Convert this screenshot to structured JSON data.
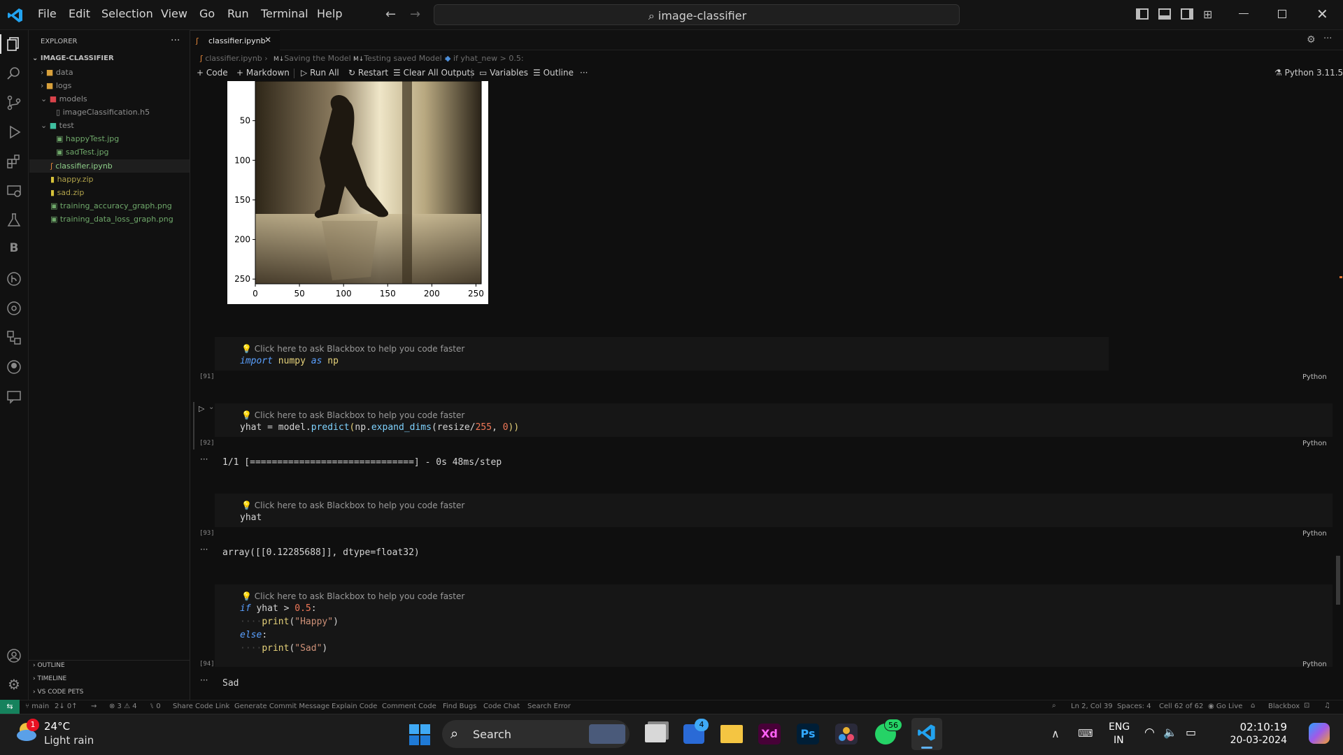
{
  "menu": [
    "File",
    "Edit",
    "Selection",
    "View",
    "Go",
    "Run",
    "Terminal",
    "Help"
  ],
  "search_title": "image-classifier",
  "explorer": {
    "title": "EXPLORER",
    "root": "IMAGE-CLASSIFIER",
    "items": [
      "data",
      "logs",
      "models",
      "imageClassification.h5",
      "test",
      "happyTest.jpg",
      "sadTest.jpg",
      "classifier.ipynb",
      "happy.zip",
      "sad.zip",
      "training_accuracy_graph.png",
      "training_data_loss_graph.png"
    ],
    "sections": [
      "OUTLINE",
      "TIMELINE",
      "VS CODE PETS"
    ]
  },
  "tab": {
    "label": "classifier.ipynb"
  },
  "breadcrumb": [
    "classifier.ipynb",
    "Saving the Model",
    "Testing saved Model",
    "if yhat_new > 0.5:"
  ],
  "toolbar": {
    "code": "Code",
    "markdown": "Markdown",
    "run_all": "Run All",
    "restart": "Restart",
    "clear": "Clear All Outputs",
    "variables": "Variables",
    "outline": "Outline",
    "kernel": "Python 3.11.5"
  },
  "plot": {
    "y_ticks": [
      "50",
      "100",
      "150",
      "200",
      "250"
    ],
    "x_ticks": [
      "0",
      "50",
      "100",
      "150",
      "200",
      "250"
    ]
  },
  "cells": [
    {
      "hint": "Click here to ask Blackbox to help you code faster",
      "num": "[91]",
      "lang": "Python",
      "code": {
        "kw": "import",
        "mod": "numpy",
        "as": "as",
        "alias": "np"
      }
    },
    {
      "hint": "Click here to ask Blackbox to help you code faster",
      "num": "[92]",
      "lang": "Python",
      "code": {
        "a": "yhat = model.",
        "fn": "predict",
        "b": "(np.",
        "fn2": "expand_dims",
        "c": "(resize/",
        "n1": "255",
        "d": ", ",
        "n2": "0",
        "e": "))"
      },
      "output": "1/1 [==============================] - 0s 48ms/step"
    },
    {
      "hint": "Click here to ask Blackbox to help you code faster",
      "num": "[93]",
      "lang": "Python",
      "code": {
        "a": "yhat"
      },
      "output": "array([[0.12285688]], dtype=float32)"
    },
    {
      "hint": "Click here to ask Blackbox to help you code faster",
      "num": "[94]",
      "lang": "Python",
      "code": {
        "if": "if",
        "cond": " yhat > ",
        "n": "0.5",
        ":": ":",
        "print": "print",
        "happy": "\"Happy\"",
        "else": "else",
        "sad": "\"Sad\""
      },
      "output": "Sad"
    }
  ],
  "status": {
    "branch": "main",
    "sync": "2↓ 0↑",
    "errors": "⊗ 3 ⚠ 4",
    "ports": "0",
    "actions": [
      "Share Code Link",
      "Generate Commit Message",
      "Explain Code",
      "Comment Code",
      "Find Bugs",
      "Code Chat",
      "Search Error"
    ],
    "right": [
      "Ln 2, Col 39",
      "Spaces: 4",
      "Cell 62 of 62",
      "Go Live",
      "Blackbox"
    ]
  },
  "taskbar": {
    "weather_temp": "24°C",
    "weather_desc": "Light rain",
    "weather_badge": "1",
    "search": "Search",
    "mail_badge": "4",
    "whatsapp_badge": "56",
    "lang1": "ENG",
    "lang2": "IN",
    "time": "02:10:19",
    "date": "20-03-2024"
  },
  "colors": {
    "accent": "#0078d4",
    "vscode": "#22a3f0",
    "folder": "#d9a13b"
  }
}
